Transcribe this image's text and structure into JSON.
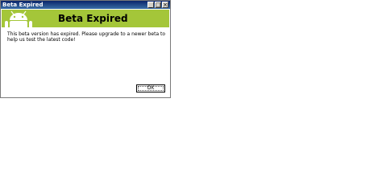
{
  "window": {
    "title": "Beta Expired",
    "controls": {
      "minimize": "_",
      "maximize": "□",
      "close": "×"
    }
  },
  "banner": {
    "title": "Beta Expired",
    "logo_icon": "android-robot-icon",
    "color": "#a4c639"
  },
  "message": {
    "text": "This beta version has expired.  Please upgrade to a newer beta to help us test the latest code!"
  },
  "buttons": {
    "ok_label": "OK"
  }
}
